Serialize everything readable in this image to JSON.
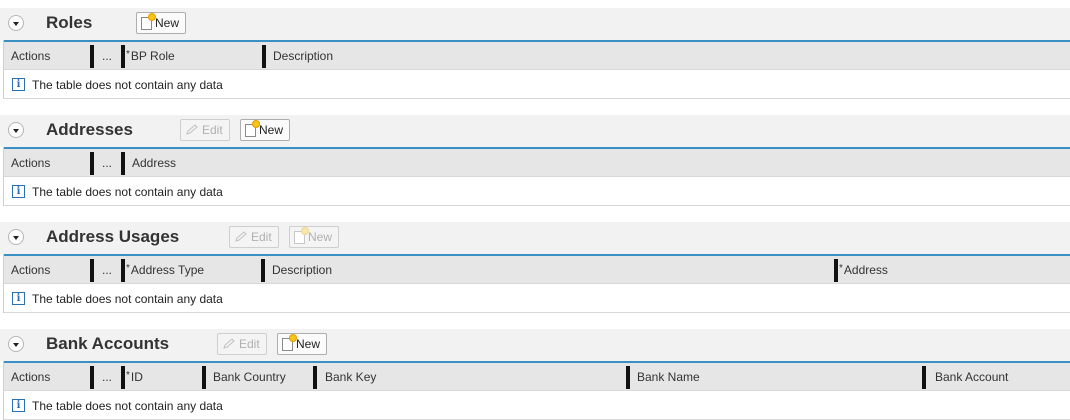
{
  "sections": {
    "roles": {
      "title": "Roles",
      "new_label": "New",
      "columns": [
        "Actions",
        "...",
        "BP Role",
        "Description"
      ],
      "empty_text": "The table does not contain any data"
    },
    "addresses": {
      "title": "Addresses",
      "edit_label": "Edit",
      "new_label": "New",
      "columns": [
        "Actions",
        "...",
        "Address"
      ],
      "empty_text": "The table does not contain any data"
    },
    "address_usages": {
      "title": "Address Usages",
      "edit_label": "Edit",
      "new_label": "New",
      "columns": [
        "Actions",
        "...",
        "Address Type",
        "Description",
        "Address"
      ],
      "empty_text": "The table does not contain any data"
    },
    "bank_accounts": {
      "title": "Bank Accounts",
      "edit_label": "Edit",
      "new_label": "New",
      "columns": [
        "Actions",
        "...",
        "ID",
        "Bank Country",
        "Bank Key",
        "Bank Name",
        "Bank Account"
      ],
      "empty_text": "The table does not contain any data"
    }
  },
  "required_marker": "*",
  "colors": {
    "header_accent": "#3a8fc4",
    "section_bg": "#f2f2f2",
    "column_header_bg": "#e6e6e6"
  }
}
